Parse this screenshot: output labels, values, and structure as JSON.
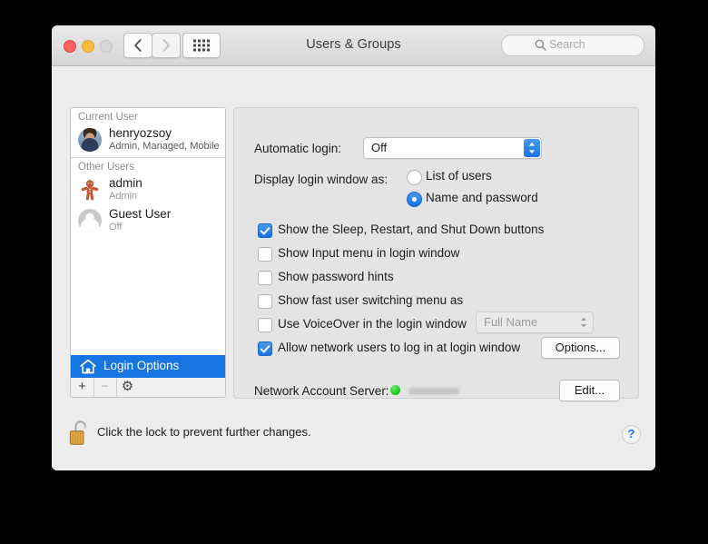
{
  "window": {
    "title": "Users & Groups",
    "traffic": {
      "close": "close-button",
      "minimize": "minimize-button",
      "zoom": "zoom-button"
    },
    "nav": {
      "back": "back-button",
      "forward": "forward-button",
      "show_all": "show-all-button"
    }
  },
  "search": {
    "placeholder": "Search"
  },
  "sidebar": {
    "groups": [
      {
        "header": "Current User",
        "users": [
          {
            "name": "henryozsoy",
            "role": "Admin, Managed, Mobile",
            "avatar": "photo-avatar",
            "dim": false
          }
        ]
      },
      {
        "header": "Other Users",
        "users": [
          {
            "name": "admin",
            "role": "Admin",
            "avatar": "gingerbread-avatar",
            "dim": true
          },
          {
            "name": "Guest User",
            "role": "Off",
            "avatar": "silhouette-avatar",
            "dim": true
          }
        ]
      }
    ],
    "login_options": {
      "label": "Login Options",
      "selected": true,
      "icon": "house-icon"
    },
    "toolbar": {
      "add": "+",
      "remove": "−",
      "gear": "⚙"
    }
  },
  "pane": {
    "automatic_login": {
      "label": "Automatic login:",
      "value": "Off",
      "options": [
        "Off"
      ]
    },
    "display_login_window": {
      "label": "Display login window as:",
      "options": [
        {
          "label": "List of users",
          "selected": false
        },
        {
          "label": "Name and password",
          "selected": true
        }
      ]
    },
    "checkboxes": [
      {
        "label": "Show the Sleep, Restart, and Shut Down buttons",
        "checked": true
      },
      {
        "label": "Show Input menu in login window",
        "checked": false
      },
      {
        "label": "Show password hints",
        "checked": false
      },
      {
        "label": "Show fast user switching menu as",
        "checked": false
      },
      {
        "label": "Use VoiceOver in the login window",
        "checked": false
      },
      {
        "label": "Allow network users to log in at login window",
        "checked": true
      }
    ],
    "fast_switch_popup": {
      "value": "Full Name",
      "enabled": false
    },
    "options_button": "Options...",
    "network_account_server": {
      "label": "Network Account Server:",
      "status": "online",
      "status_color": "#21c521",
      "value": "",
      "edit_button": "Edit..."
    }
  },
  "footer": {
    "lock_icon": "unlocked-padlock-icon",
    "lock_text": "Click the lock to prevent further changes.",
    "help_label": "?"
  }
}
